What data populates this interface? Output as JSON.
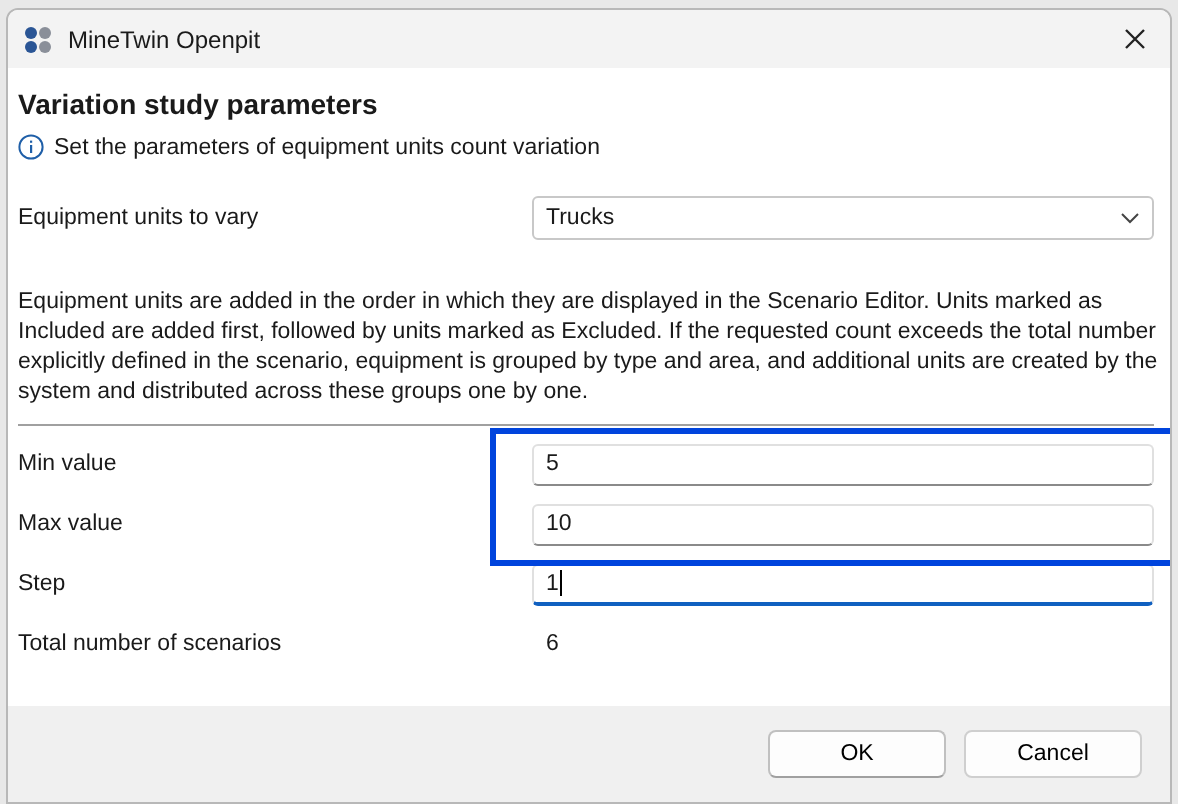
{
  "window": {
    "title": "MineTwin Openpit"
  },
  "header": {
    "title": "Variation study parameters",
    "message": "Set the parameters of equipment units count variation"
  },
  "equipment": {
    "label": "Equipment units to vary",
    "value": "Trucks"
  },
  "description": "Equipment units are added in the order in which they are displayed in the Scenario Editor. Units marked as Included are added first, followed by units marked as Excluded. If the requested count exceeds the total number explicitly defined in the scenario, equipment is grouped by type and area, and additional units are created by the system and distributed across these groups one by one.",
  "fields": [
    {
      "kind": "input",
      "label": "Min value",
      "value": "5",
      "focused": false,
      "highlighted": true
    },
    {
      "kind": "input",
      "label": "Max value",
      "value": "10",
      "focused": false,
      "highlighted": true
    },
    {
      "kind": "input",
      "label": "Step",
      "value": "1",
      "focused": true,
      "highlighted": false
    },
    {
      "kind": "readout",
      "label": "Total number of scenarios",
      "value": "6"
    }
  ],
  "buttons": [
    {
      "label": "OK",
      "default": true
    },
    {
      "label": "Cancel",
      "default": false
    }
  ]
}
